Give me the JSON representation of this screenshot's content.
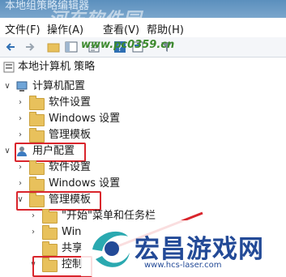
{
  "window": {
    "title": "本地组策略编辑器"
  },
  "watermark": {
    "top": "河东软件园",
    "url": "www.pc0359.cn",
    "logo_text": "宏昌游戏网",
    "logo_url": "www.hcs-laser.com"
  },
  "menu": {
    "items": [
      "文件(F)",
      "操作(A)",
      "查看(V)",
      "帮助(H)"
    ]
  },
  "toolbar": {
    "icons": [
      "back-icon",
      "forward-icon",
      "up-folder-icon",
      "show-hide-tree-icon",
      "export-list-icon",
      "help-icon",
      "properties-icon",
      "filter-icon"
    ]
  },
  "tree": {
    "root": "本地计算机 策略",
    "computer_config": "计算机配置",
    "cc_software": "软件设置",
    "cc_windows": "Windows 设置",
    "cc_admin": "管理模板",
    "user_config": "用户配置",
    "uc_software": "软件设置",
    "uc_windows": "Windows 设置",
    "uc_admin": "管理模板",
    "start_menu": "\"开始\"菜单和任务栏",
    "win_comp": "Win",
    "shared": "共享",
    "control": "控制"
  },
  "colors": {
    "highlight": "#d9252c",
    "folder": "#e8c15c",
    "logo": "#234a97"
  }
}
